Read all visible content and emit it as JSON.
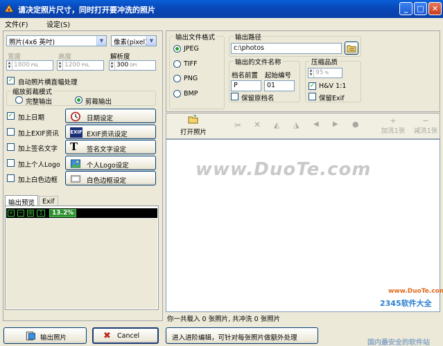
{
  "window": {
    "title": "请决定照片尺寸，同时打开要冲洗的照片",
    "minimize": "_",
    "maximize": "□",
    "close": "✕"
  },
  "menu": {
    "file": "文件(F)",
    "settings": "设定(S)"
  },
  "size": {
    "selected": "照片(4x6 英吋)",
    "unit": "像素(pixel)",
    "width_label": "宽度",
    "height_label": "高度",
    "dpi_label": "解析度",
    "width": "1800",
    "height": "1200",
    "dpi": "300",
    "width_unit": "PXL",
    "height_unit": "PXL",
    "dpi_unit": "DPI"
  },
  "auto_rotate": {
    "label": "自动照片横直幅处理",
    "checked": true
  },
  "crop_mode": {
    "title": "缩放剪裁模式",
    "full": "完整输出",
    "crop": "剪裁输出",
    "selected": "crop"
  },
  "options": [
    {
      "label": "加上日期",
      "checked": true,
      "button": "日期设定",
      "icon": "clock-icon"
    },
    {
      "label": "加上EXIF资讯",
      "checked": false,
      "button": "EXIF资讯设定",
      "icon": "exif-icon",
      "icon_text": "EXIF"
    },
    {
      "label": "加上签名文字",
      "checked": false,
      "button": "签名文字设定",
      "icon": "text-t-icon",
      "icon_text": "T"
    },
    {
      "label": "加上个人Logo",
      "checked": false,
      "button": "个人Logo设定",
      "icon": "logo-image-icon"
    },
    {
      "label": "加上白色边框",
      "checked": false,
      "button": "白色边框设定",
      "icon": "border-frame-icon"
    }
  ],
  "preview": {
    "tab1": "输出预览",
    "tab2": "Exif",
    "zoom": "13.2%"
  },
  "format": {
    "title": "输出文件格式",
    "options": [
      "JPEG",
      "TIFF",
      "PNG",
      "BMP"
    ],
    "selected": "JPEG"
  },
  "output_path": {
    "title": "输出路径",
    "value": "c:\\photos"
  },
  "file_name": {
    "title": "输出的文件名称",
    "prefix_label": "档名前置",
    "start_label": "起始编号",
    "prefix": "P",
    "start": "01",
    "keep_original": "保留原档名"
  },
  "quality": {
    "title": "压缩品质",
    "value": "95",
    "unit": "%",
    "hv": "H&V 1:1",
    "hv_checked": true,
    "keep_exif": "保留Exif",
    "keep_exif_checked": false
  },
  "toolbar": {
    "open": "打开照片",
    "add": "加洗1张",
    "reduce": "减洗1张"
  },
  "status": "你一共载入 0 张照片, 共冲洗 0 张照片",
  "bottom": {
    "output": "输出照片",
    "cancel": "Cancel",
    "advanced": "进入进阶编辑，可针对每张照片做额外处理"
  },
  "watermarks": {
    "main": "www.DuoTe.com",
    "site": "www.DuoTe.com",
    "brand": "2345软件大全",
    "slogan": "国内最安全的软件站"
  }
}
